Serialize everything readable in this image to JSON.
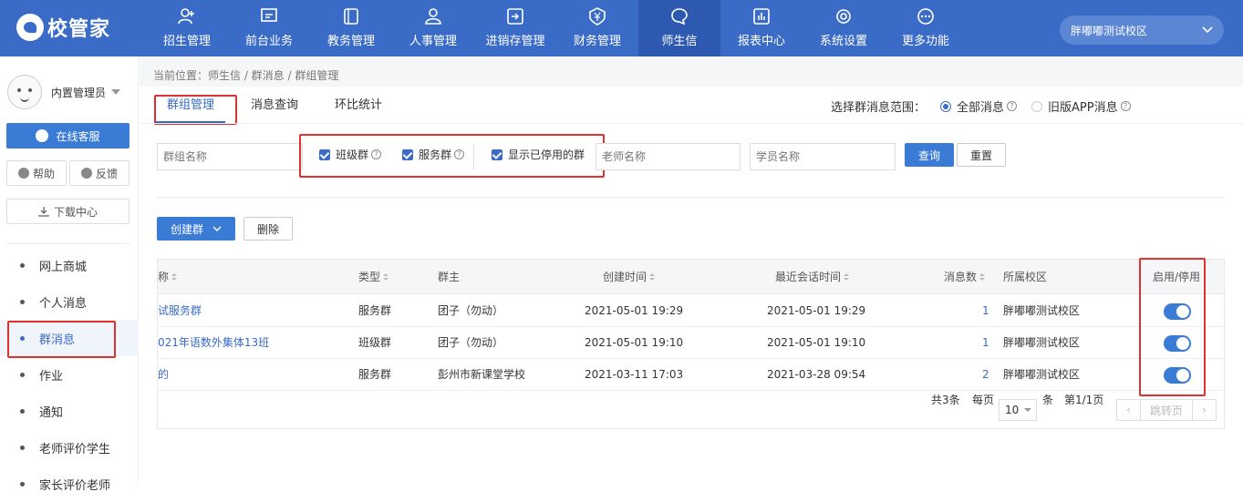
{
  "app": {
    "logo_text": "校管家",
    "campus": "胖嘟嘟测试校区"
  },
  "nav": [
    {
      "label": "招生管理",
      "icon": "person-add-icon"
    },
    {
      "label": "前台业务",
      "icon": "monitor-icon"
    },
    {
      "label": "教务管理",
      "icon": "book-icon"
    },
    {
      "label": "人事管理",
      "icon": "person-icon"
    },
    {
      "label": "进销存管理",
      "icon": "inventory-icon"
    },
    {
      "label": "财务管理",
      "icon": "yen-shield-icon"
    },
    {
      "label": "师生信",
      "icon": "chat-icon"
    },
    {
      "label": "报表中心",
      "icon": "chart-icon"
    },
    {
      "label": "系统设置",
      "icon": "gear-icon"
    },
    {
      "label": "更多功能",
      "icon": "more-icon"
    }
  ],
  "active_nav": "师生信",
  "sidebar": {
    "user": "内置管理员",
    "service": "在线客服",
    "help": "帮助",
    "feedback": "反馈",
    "download": "下载中心",
    "items": [
      "网上商城",
      "个人消息",
      "群消息",
      "作业",
      "通知",
      "老师评价学生",
      "家长评价老师"
    ],
    "active": "群消息"
  },
  "breadcrumb": "当前位置：师生信 / 群消息 / 群组管理",
  "tabs": [
    "群组管理",
    "消息查询",
    "环比统计"
  ],
  "scope": {
    "label": "选择群消息范围：",
    "options": [
      "全部消息",
      "旧版APP消息"
    ],
    "selected": "全部消息"
  },
  "filters": {
    "group_name_placeholder": "群组名称",
    "teacher_placeholder": "老师名称",
    "student_placeholder": "学员名称",
    "checks": [
      "班级群",
      "服务群",
      "显示已停用的群"
    ],
    "query": "查询",
    "reset": "重置"
  },
  "actions": {
    "create": "创建群",
    "delete": "删除"
  },
  "table": {
    "headers": [
      "称",
      "类型",
      "群主",
      "创建时间",
      "最近会话时间",
      "消息数",
      "所属校区",
      "启用/停用"
    ],
    "rows": [
      {
        "name": "试服务群",
        "type": "服务群",
        "owner": "团子（勿动）",
        "created": "2021-05-01 19:29",
        "last": "2021-05-01 19:29",
        "count": "1",
        "campus": "胖嘟嘟测试校区",
        "enabled": true
      },
      {
        "name": "021年语数外集体13班",
        "type": "班级群",
        "owner": "团子（勿动）",
        "created": "2021-05-01 19:10",
        "last": "2021-05-01 19:10",
        "count": "1",
        "campus": "胖嘟嘟测试校区",
        "enabled": true
      },
      {
        "name": "的",
        "type": "服务群",
        "owner": "彭州市新课堂学校",
        "created": "2021-03-11 17:03",
        "last": "2021-03-28 09:54",
        "count": "2",
        "campus": "胖嘟嘟测试校区",
        "enabled": true
      }
    ]
  },
  "pager": {
    "total": "共3条",
    "per_page_label": "每页",
    "per_page": "10",
    "unit": "条",
    "page": "第1/1页",
    "jump": "跳转页"
  }
}
